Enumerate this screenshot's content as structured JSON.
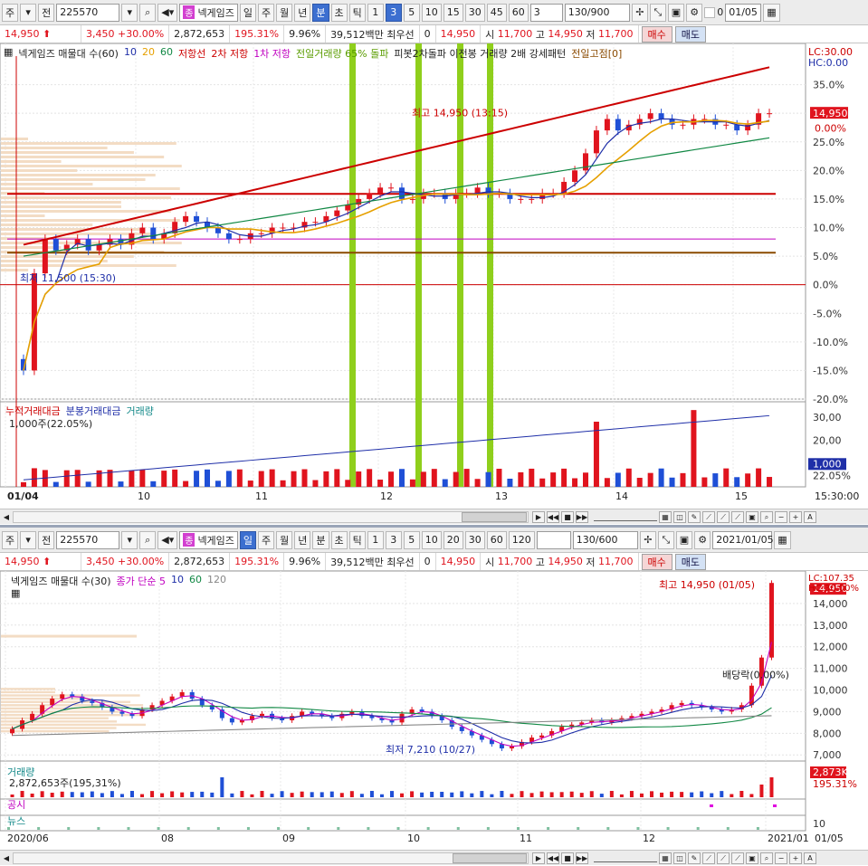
{
  "top": {
    "toolbar": {
      "market": "주",
      "prefix": "전",
      "code": "225570",
      "stock_name": "넥게임즈",
      "jong_badge": "종",
      "periods": [
        "일",
        "주",
        "월",
        "년",
        "분",
        "초",
        "틱"
      ],
      "active_period": "분",
      "intervals": [
        "1",
        "3",
        "5",
        "10",
        "15",
        "30",
        "45",
        "60"
      ],
      "active_interval": "3",
      "interval_value": "3",
      "count": "130",
      "count_max": "/900",
      "date": "01/05",
      "checkbox_label": "0"
    },
    "info": {
      "price": "14,950",
      "change": "3,450",
      "change_pct": "+30.00%",
      "volume": "2,872,653",
      "volume_ratio": "195.31%",
      "turnover": "9.96%",
      "amount": "39,512백만",
      "line_label": "최우선",
      "line_value": "0",
      "last": "14,950",
      "open_label": "시",
      "open": "11,700",
      "high_label": "고",
      "high": "14,950",
      "low_label": "저",
      "low": "11,700",
      "buy": "매수",
      "sell": "매도"
    },
    "legend": {
      "title": "넥게임즈 매물대 수(60)",
      "ma": [
        "10",
        "20",
        "60"
      ],
      "items": [
        "저항선",
        "2차 저항",
        "1차 저항",
        "전일거래량 65% 돌파",
        "피봇2차돌파 이전봉 거래량 2배 강세패턴",
        "전일고점[0]"
      ],
      "lc": "LC:30.00",
      "hc": "HC:0.00"
    },
    "annotations": {
      "high": "최고 14,950 (13:15)",
      "low": "최저 11,500 (15:30)",
      "price_tag": "14,950",
      "price_tag_pct": "0.00%"
    },
    "volume_legend": {
      "items": [
        "누적거래대금",
        "분봉거래대금",
        "거래량"
      ],
      "sub": "1,000주(22.05%)",
      "tag": "1,000",
      "tag_pct": "22.05%"
    },
    "x_labels": [
      "01/04",
      "10",
      "11",
      "12",
      "13",
      "14",
      "15"
    ],
    "time_label": "15:30:00"
  },
  "bottom": {
    "toolbar": {
      "market": "주",
      "prefix": "전",
      "code": "225570",
      "stock_name": "넥게임즈",
      "jong_badge": "종",
      "periods": [
        "일",
        "주",
        "월",
        "년",
        "분",
        "초",
        "틱"
      ],
      "active_period": "일",
      "intervals": [
        "1",
        "3",
        "5",
        "10",
        "20",
        "30",
        "60",
        "120"
      ],
      "count": "130",
      "count_max": "/600",
      "date": "2021/01/05"
    },
    "info": {
      "price": "14,950",
      "change": "3,450",
      "change_pct": "+30.00%",
      "volume": "2,872,653",
      "volume_ratio": "195.31%",
      "turnover": "9.96%",
      "amount": "39,512백만",
      "line_label": "최우선",
      "line_value": "0",
      "last": "14,950",
      "open_label": "시",
      "open": "11,700",
      "high_label": "고",
      "high": "14,950",
      "low_label": "저",
      "low": "11,700",
      "buy": "매수",
      "sell": "매도"
    },
    "legend": {
      "title": "넥게임즈 매물대 수(30)",
      "ma_label": "종가 단순 5",
      "ma": [
        "10",
        "60",
        "120"
      ],
      "lc": "LC:107.35",
      "hc": "HC:30.00%"
    },
    "annotations": {
      "high": "최고 14,950 (01/05)",
      "low": "최저 7,210 (10/27)",
      "dividend": "배당락(0.00%)",
      "price_tag": "14,950"
    },
    "volume_legend": {
      "title": "거래량",
      "sub": "2,872,653주(195,31%)",
      "tag": "2,873K",
      "tag_pct": "195.31%"
    },
    "disclosure": "공시",
    "news": "뉴스",
    "news_scale": "10",
    "x_labels": [
      "2020/06",
      "08",
      "09",
      "10",
      "11",
      "12",
      "2021/01"
    ],
    "date_label": "01/05"
  },
  "chart_data": [
    {
      "type": "candlestick",
      "title": "넥게임즈 매물대 수(60)",
      "x_labels": [
        "01/04",
        "10",
        "11",
        "12",
        "13",
        "14",
        "15"
      ],
      "y_ticks": [
        "35.0%",
        "30.0%",
        "25.0%",
        "20.0%",
        "15.0%",
        "10.0%",
        "5.0%",
        "0.0%",
        "-5.0%",
        "-10.0%",
        "-15.0%",
        "-20.0%"
      ],
      "ylim": [
        -20,
        40
      ],
      "close_pct": [
        -15,
        2,
        8,
        6,
        7,
        8,
        6,
        7,
        8,
        7,
        9,
        10,
        8,
        9,
        11,
        12,
        11,
        10,
        9,
        8,
        8,
        9,
        9,
        10,
        10,
        10,
        11,
        11,
        12,
        13,
        14,
        15,
        16,
        17,
        17,
        15,
        15,
        16,
        16,
        15,
        16,
        16,
        17,
        16,
        16,
        15,
        15,
        15,
        16,
        16,
        18,
        20,
        23,
        27,
        29,
        27,
        28,
        29,
        30,
        29,
        28,
        28,
        29,
        29,
        28,
        28,
        27,
        28,
        30,
        30
      ],
      "high_pct": 30,
      "low_pct": -13,
      "volume_y_ticks": [
        "30,00",
        "20,00",
        "10,00"
      ],
      "volume_ylim": [
        0,
        35
      ]
    },
    {
      "type": "candlestick",
      "title": "넥게임즈 매물대 수(30)",
      "x_labels": [
        "2020/06",
        "08",
        "09",
        "10",
        "11",
        "12",
        "2021/01"
      ],
      "y_ticks": [
        "14,000",
        "13,000",
        "12,000",
        "11,000",
        "10,000",
        "9,000",
        "8,000",
        "7,000"
      ],
      "ylim": [
        6800,
        15000
      ],
      "close": [
        8200,
        8600,
        8900,
        9300,
        9600,
        9800,
        9700,
        9500,
        9400,
        9200,
        9000,
        8900,
        8800,
        9100,
        9300,
        9500,
        9700,
        9900,
        9600,
        9300,
        9100,
        8700,
        8500,
        8600,
        8800,
        8900,
        8700,
        8600,
        8800,
        9000,
        8900,
        8800,
        8700,
        8900,
        9000,
        8800,
        8700,
        8600,
        8500,
        8900,
        9100,
        9000,
        8800,
        8600,
        8300,
        8100,
        7900,
        7700,
        7500,
        7300,
        7400,
        7600,
        7800,
        7900,
        8100,
        8300,
        8400,
        8500,
        8600,
        8500,
        8600,
        8700,
        8800,
        8900,
        9000,
        9100,
        9300,
        9400,
        9300,
        9200,
        9100,
        9000,
        9100,
        9300,
        10200,
        11500,
        14950
      ],
      "high": 14950,
      "low": 7210
    }
  ]
}
